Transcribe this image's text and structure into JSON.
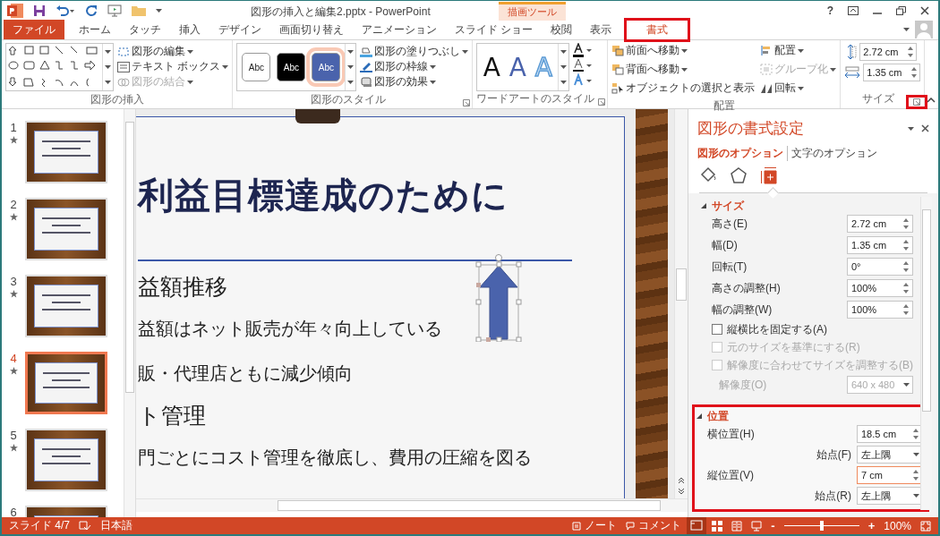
{
  "window": {
    "title": "図形の挿入と編集2.pptx - PowerPoint",
    "context_label": "描画ツール",
    "help": "?"
  },
  "tabs": [
    {
      "label": "ファイル",
      "kind": "file",
      "selected": false,
      "highlighted": false
    },
    {
      "label": "ホーム",
      "kind": "normal",
      "selected": false,
      "highlighted": false
    },
    {
      "label": "タッチ",
      "kind": "normal",
      "selected": false,
      "highlighted": false
    },
    {
      "label": "挿入",
      "kind": "normal",
      "selected": false,
      "highlighted": false
    },
    {
      "label": "デザイン",
      "kind": "normal",
      "selected": false,
      "highlighted": false
    },
    {
      "label": "画面切り替え",
      "kind": "normal",
      "selected": false,
      "highlighted": false
    },
    {
      "label": "アニメーション",
      "kind": "normal",
      "selected": false,
      "highlighted": false
    },
    {
      "label": "スライド ショー",
      "kind": "normal",
      "selected": false,
      "highlighted": false
    },
    {
      "label": "校閲",
      "kind": "normal",
      "selected": false,
      "highlighted": false
    },
    {
      "label": "表示",
      "kind": "normal",
      "selected": false,
      "highlighted": false
    },
    {
      "label": "書式",
      "kind": "context",
      "selected": true,
      "highlighted": true
    }
  ],
  "ribbon": {
    "insert": {
      "label": "図形の挿入",
      "buttons": [
        {
          "label": "図形の編集",
          "disabled": false
        },
        {
          "label": "テキスト ボックス",
          "disabled": false
        },
        {
          "label": "図形の結合",
          "disabled": true
        }
      ]
    },
    "styles": {
      "label": "図形のスタイル",
      "swatches": [
        {
          "text": "Abc",
          "color": "#ffffff",
          "selected": false
        },
        {
          "text": "Abc",
          "color": "#000000",
          "selected": false
        },
        {
          "text": "Abc",
          "color": "#4a63ac",
          "selected": true
        }
      ],
      "buttons": [
        {
          "label": "図形の塗りつぶし",
          "disabled": false
        },
        {
          "label": "図形の枠線",
          "disabled": false
        },
        {
          "label": "図形の効果",
          "disabled": false
        }
      ]
    },
    "wordart": {
      "label": "ワードアートのスタイル",
      "samples": [
        {
          "text": "A",
          "kind": "solid"
        },
        {
          "text": "A",
          "kind": "blue"
        },
        {
          "text": "A",
          "kind": "outline"
        }
      ]
    },
    "arrange": {
      "label": "配置",
      "buttons": [
        {
          "label": "前面へ移動",
          "disabled": false
        },
        {
          "label": "背面へ移動",
          "disabled": false
        },
        {
          "label": "オブジェクトの選択と表示",
          "disabled": false
        },
        {
          "label": "配置",
          "disabled": false
        },
        {
          "label": "グループ化",
          "disabled": true
        },
        {
          "label": "回転",
          "disabled": false
        }
      ]
    },
    "size": {
      "label": "サイズ",
      "height": "2.72 cm",
      "width": "1.35 cm",
      "launcher_highlighted": true
    }
  },
  "thumbnails": [
    {
      "number": "1",
      "selected": false
    },
    {
      "number": "2",
      "selected": false
    },
    {
      "number": "3",
      "selected": false
    },
    {
      "number": "4",
      "selected": true
    },
    {
      "number": "5",
      "selected": false
    },
    {
      "number": "6",
      "selected": false
    }
  ],
  "slide": {
    "title": "利益目標達成のために",
    "lines": [
      {
        "kind": "heading",
        "text": "益額推移"
      },
      {
        "kind": "bullet",
        "text": "益額はネット販売が年々向上している"
      },
      {
        "kind": "bullet",
        "text": "販・代理店ともに減少傾向"
      },
      {
        "kind": "heading",
        "text": "ト管理"
      },
      {
        "kind": "bullet",
        "text": "門ごとにコスト管理を徹底し、費用の圧縮を図る"
      }
    ]
  },
  "format_pane": {
    "title": "図形の書式設定",
    "option_tabs": [
      {
        "label": "図形のオプション",
        "selected": true
      },
      {
        "label": "文字のオプション",
        "selected": false
      }
    ],
    "icon_tabs": [
      {
        "kind": "fill",
        "selected": false
      },
      {
        "kind": "effects",
        "selected": false
      },
      {
        "kind": "size",
        "selected": true
      }
    ],
    "sections": [
      {
        "title": "サイズ",
        "expanded": true,
        "highlighted": false,
        "rows": [
          {
            "kind": "spin",
            "label": "高さ(E)",
            "value": "2.72 cm",
            "focused": false
          },
          {
            "kind": "spin",
            "label": "幅(D)",
            "value": "1.35 cm",
            "focused": false
          },
          {
            "kind": "spin",
            "label": "回転(T)",
            "value": "0°",
            "focused": false
          },
          {
            "kind": "spin",
            "label": "高さの調整(H)",
            "value": "100%",
            "focused": false
          },
          {
            "kind": "spin",
            "label": "幅の調整(W)",
            "value": "100%",
            "focused": false
          },
          {
            "kind": "checkbox",
            "label": "縦横比を固定する(A)",
            "checked": false,
            "disabled": false
          },
          {
            "kind": "checkbox",
            "label": "元のサイズを基準にする(R)",
            "checked": false,
            "disabled": true
          },
          {
            "kind": "checkbox",
            "label": "解像度に合わせてサイズを調整する(B)",
            "checked": false,
            "disabled": true
          },
          {
            "kind": "dropdown",
            "label": "解像度(O)",
            "value": "640 x 480",
            "disabled": true
          }
        ]
      },
      {
        "title": "位置",
        "expanded": true,
        "highlighted": true,
        "rows": [
          {
            "kind": "spin",
            "label": "横位置(H)",
            "value": "18.5 cm",
            "focused": false
          },
          {
            "kind": "origin",
            "label": "始点(F)",
            "value": "左上隅",
            "disabled": false
          },
          {
            "kind": "spin",
            "label": "縦位置(V)",
            "value": "7 cm",
            "focused": true
          },
          {
            "kind": "origin",
            "label": "始点(R)",
            "value": "左上隅",
            "disabled": false
          }
        ]
      }
    ]
  },
  "status_bar": {
    "slide": "スライド 4/7",
    "language": "日本語",
    "notes": "ノート",
    "comments": "コメント",
    "zoom_out": "-",
    "zoom_slider": {
      "level": 0.5
    },
    "zoom_in": "+",
    "zoom": "100%"
  }
}
